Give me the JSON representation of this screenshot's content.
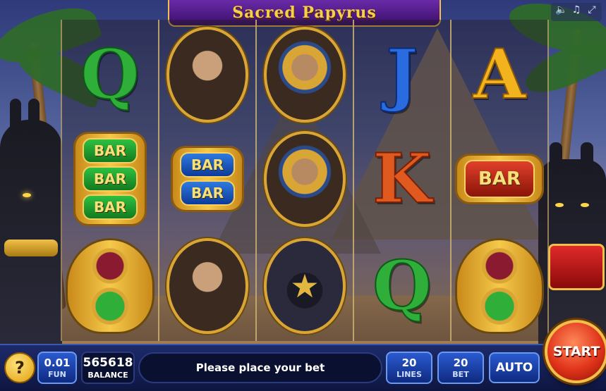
{
  "game": {
    "title": "Sacred Papyrus"
  },
  "top_icons": [
    "speaker-icon",
    "music-icon",
    "fullscreen-icon"
  ],
  "reels": [
    [
      "Q",
      "BAR x3 green",
      "Scarab"
    ],
    [
      "Cleopatra",
      "BAR x2 blue",
      "Cleopatra"
    ],
    [
      "Pharaoh",
      "Pharaoh",
      "Anubis"
    ],
    [
      "J",
      "K",
      "Q"
    ],
    [
      "A",
      "BAR red",
      "Scarab"
    ]
  ],
  "bar_text": "BAR",
  "letters": {
    "q": "Q",
    "j": "J",
    "k": "K",
    "a": "A"
  },
  "panel": {
    "help_label": "?",
    "denomination_value": "0.01",
    "denomination_label": "FUN",
    "balance_value": "565618",
    "balance_label": "BALANCE",
    "message": "Please place your bet",
    "lines_value": "20",
    "lines_label": "LINES",
    "bet_value": "20",
    "bet_label": "BET",
    "auto_label": "AUTO",
    "start_label": "START"
  },
  "colors": {
    "title_bg": "#4a1a80",
    "title_text": "#f7d04a",
    "panel_bg": "#0e1640",
    "button_blue": "#2a5ad0",
    "start_red": "#e0341a",
    "gold": "#f2c04a"
  }
}
